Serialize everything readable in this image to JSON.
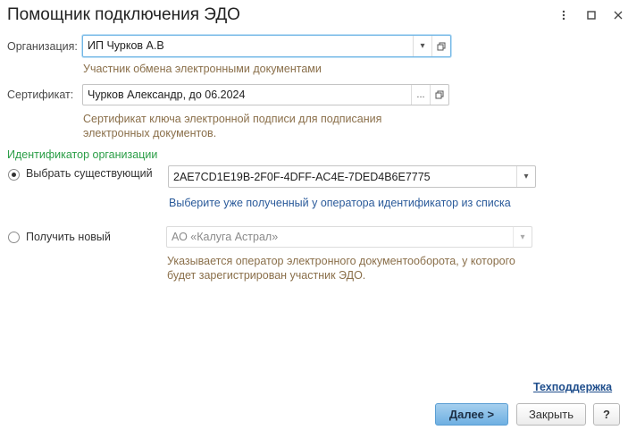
{
  "window": {
    "title": "Помощник подключения ЭДО",
    "more_icon": "more-vertical-icon",
    "maximize_icon": "maximize-icon",
    "close_icon": "close-icon"
  },
  "organization": {
    "label": "Организация:",
    "value": "ИП Чурков А.В",
    "hint": "Участник обмена электронными документами"
  },
  "certificate": {
    "label": "Сертификат:",
    "value": "Чурков Александр, до 06.2024",
    "hint_line1": "Сертификат ключа электронной подписи для подписания",
    "hint_line2": "электронных документов."
  },
  "identifier": {
    "section_title": "Идентификатор организации",
    "existing": {
      "label": "Выбрать существующий",
      "selected": true,
      "value": "2AE7CD1E19B-2F0F-4DFF-AC4E-7DED4B6E7775",
      "hint": "Выберите уже полученный у оператора идентификатор из списка"
    },
    "new": {
      "label": "Получить новый",
      "selected": false,
      "value": "АО «Калуга Астрал»",
      "hint_line1": "Указывается оператор электронного документооборота, у которого",
      "hint_line2": "будет зарегистрирован участник ЭДО."
    }
  },
  "footer": {
    "support_link": "Техподдержка",
    "next_button": "Далее >",
    "close_button": "Закрыть",
    "help_button": "?"
  }
}
